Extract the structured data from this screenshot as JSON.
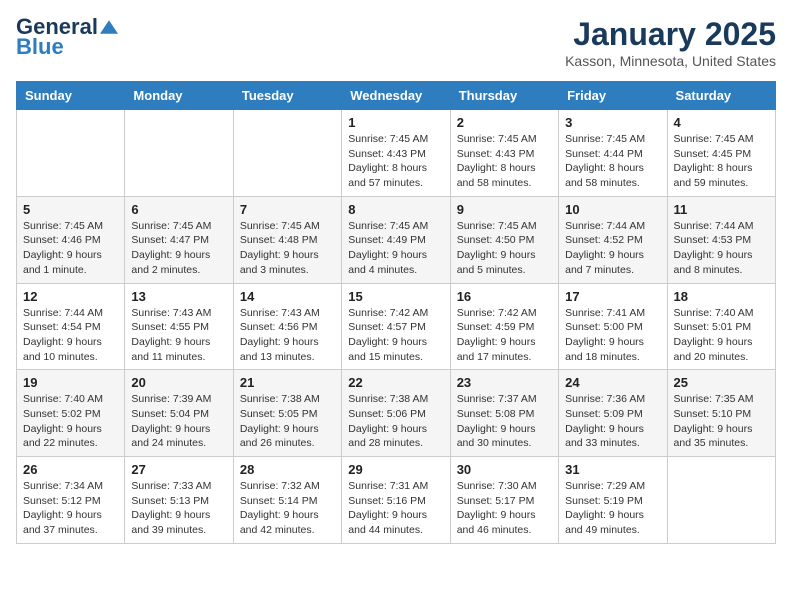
{
  "logo": {
    "general": "General",
    "blue": "Blue"
  },
  "title": "January 2025",
  "location": "Kasson, Minnesota, United States",
  "days_of_week": [
    "Sunday",
    "Monday",
    "Tuesday",
    "Wednesday",
    "Thursday",
    "Friday",
    "Saturday"
  ],
  "weeks": [
    [
      {
        "day": "",
        "info": ""
      },
      {
        "day": "",
        "info": ""
      },
      {
        "day": "",
        "info": ""
      },
      {
        "day": "1",
        "info": "Sunrise: 7:45 AM\nSunset: 4:43 PM\nDaylight: 8 hours\nand 57 minutes."
      },
      {
        "day": "2",
        "info": "Sunrise: 7:45 AM\nSunset: 4:43 PM\nDaylight: 8 hours\nand 58 minutes."
      },
      {
        "day": "3",
        "info": "Sunrise: 7:45 AM\nSunset: 4:44 PM\nDaylight: 8 hours\nand 58 minutes."
      },
      {
        "day": "4",
        "info": "Sunrise: 7:45 AM\nSunset: 4:45 PM\nDaylight: 8 hours\nand 59 minutes."
      }
    ],
    [
      {
        "day": "5",
        "info": "Sunrise: 7:45 AM\nSunset: 4:46 PM\nDaylight: 9 hours\nand 1 minute."
      },
      {
        "day": "6",
        "info": "Sunrise: 7:45 AM\nSunset: 4:47 PM\nDaylight: 9 hours\nand 2 minutes."
      },
      {
        "day": "7",
        "info": "Sunrise: 7:45 AM\nSunset: 4:48 PM\nDaylight: 9 hours\nand 3 minutes."
      },
      {
        "day": "8",
        "info": "Sunrise: 7:45 AM\nSunset: 4:49 PM\nDaylight: 9 hours\nand 4 minutes."
      },
      {
        "day": "9",
        "info": "Sunrise: 7:45 AM\nSunset: 4:50 PM\nDaylight: 9 hours\nand 5 minutes."
      },
      {
        "day": "10",
        "info": "Sunrise: 7:44 AM\nSunset: 4:52 PM\nDaylight: 9 hours\nand 7 minutes."
      },
      {
        "day": "11",
        "info": "Sunrise: 7:44 AM\nSunset: 4:53 PM\nDaylight: 9 hours\nand 8 minutes."
      }
    ],
    [
      {
        "day": "12",
        "info": "Sunrise: 7:44 AM\nSunset: 4:54 PM\nDaylight: 9 hours\nand 10 minutes."
      },
      {
        "day": "13",
        "info": "Sunrise: 7:43 AM\nSunset: 4:55 PM\nDaylight: 9 hours\nand 11 minutes."
      },
      {
        "day": "14",
        "info": "Sunrise: 7:43 AM\nSunset: 4:56 PM\nDaylight: 9 hours\nand 13 minutes."
      },
      {
        "day": "15",
        "info": "Sunrise: 7:42 AM\nSunset: 4:57 PM\nDaylight: 9 hours\nand 15 minutes."
      },
      {
        "day": "16",
        "info": "Sunrise: 7:42 AM\nSunset: 4:59 PM\nDaylight: 9 hours\nand 17 minutes."
      },
      {
        "day": "17",
        "info": "Sunrise: 7:41 AM\nSunset: 5:00 PM\nDaylight: 9 hours\nand 18 minutes."
      },
      {
        "day": "18",
        "info": "Sunrise: 7:40 AM\nSunset: 5:01 PM\nDaylight: 9 hours\nand 20 minutes."
      }
    ],
    [
      {
        "day": "19",
        "info": "Sunrise: 7:40 AM\nSunset: 5:02 PM\nDaylight: 9 hours\nand 22 minutes."
      },
      {
        "day": "20",
        "info": "Sunrise: 7:39 AM\nSunset: 5:04 PM\nDaylight: 9 hours\nand 24 minutes."
      },
      {
        "day": "21",
        "info": "Sunrise: 7:38 AM\nSunset: 5:05 PM\nDaylight: 9 hours\nand 26 minutes."
      },
      {
        "day": "22",
        "info": "Sunrise: 7:38 AM\nSunset: 5:06 PM\nDaylight: 9 hours\nand 28 minutes."
      },
      {
        "day": "23",
        "info": "Sunrise: 7:37 AM\nSunset: 5:08 PM\nDaylight: 9 hours\nand 30 minutes."
      },
      {
        "day": "24",
        "info": "Sunrise: 7:36 AM\nSunset: 5:09 PM\nDaylight: 9 hours\nand 33 minutes."
      },
      {
        "day": "25",
        "info": "Sunrise: 7:35 AM\nSunset: 5:10 PM\nDaylight: 9 hours\nand 35 minutes."
      }
    ],
    [
      {
        "day": "26",
        "info": "Sunrise: 7:34 AM\nSunset: 5:12 PM\nDaylight: 9 hours\nand 37 minutes."
      },
      {
        "day": "27",
        "info": "Sunrise: 7:33 AM\nSunset: 5:13 PM\nDaylight: 9 hours\nand 39 minutes."
      },
      {
        "day": "28",
        "info": "Sunrise: 7:32 AM\nSunset: 5:14 PM\nDaylight: 9 hours\nand 42 minutes."
      },
      {
        "day": "29",
        "info": "Sunrise: 7:31 AM\nSunset: 5:16 PM\nDaylight: 9 hours\nand 44 minutes."
      },
      {
        "day": "30",
        "info": "Sunrise: 7:30 AM\nSunset: 5:17 PM\nDaylight: 9 hours\nand 46 minutes."
      },
      {
        "day": "31",
        "info": "Sunrise: 7:29 AM\nSunset: 5:19 PM\nDaylight: 9 hours\nand 49 minutes."
      },
      {
        "day": "",
        "info": ""
      }
    ]
  ]
}
